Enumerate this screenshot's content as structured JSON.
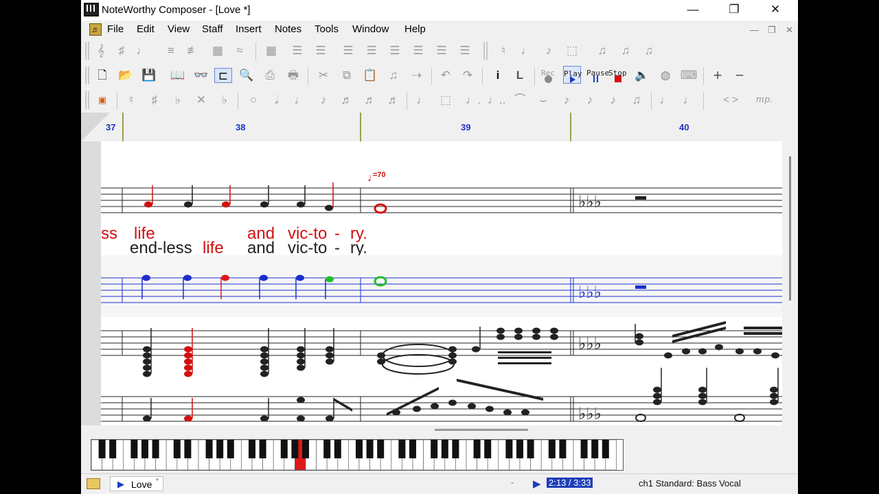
{
  "window": {
    "title": "NoteWorthy Composer - [Love *]"
  },
  "menu": [
    "File",
    "Edit",
    "View",
    "Staff",
    "Insert",
    "Notes",
    "Tools",
    "Window",
    "Help"
  ],
  "toolbar": {
    "rec_label": "Rec",
    "play_label": "Play",
    "pause_label": "Pause",
    "stop_label": "Stop",
    "zoom_in": "+",
    "zoom_out": "−",
    "hairpins": "< >",
    "dynamic": "mp."
  },
  "ruler": {
    "measures": [
      "37",
      "38",
      "39",
      "40"
    ]
  },
  "score": {
    "tempo": "=70",
    "lyrics_line1": [
      {
        "text": "ss",
        "color": "#d21010"
      },
      {
        "text": "life",
        "color": "#d21010"
      },
      {
        "text": "and",
        "color": "#d21010"
      },
      {
        "text": "vic-to",
        "color": "#d21010"
      },
      {
        "text": "-",
        "color": "#d21010"
      },
      {
        "text": "ry.",
        "color": "#d21010"
      }
    ],
    "lyrics_line2": [
      {
        "text": "end-less",
        "color": "#222222"
      },
      {
        "text": "life",
        "color": "#d21010"
      },
      {
        "text": "and",
        "color": "#222222"
      },
      {
        "text": "vic-to",
        "color": "#222222"
      },
      {
        "text": "-",
        "color": "#222222"
      },
      {
        "text": "ry.",
        "color": "#222222"
      }
    ],
    "colors": {
      "active_staff": "#1b2fd0",
      "highlight": "#e01818",
      "played_green": "#1fbf2a",
      "measure_line": "#9aa04a"
    }
  },
  "statusbar": {
    "tab_label": "Love",
    "tab_modified": "*",
    "indicator": "-",
    "time": "2:13 / 3:33",
    "status": "ch1 Standard: Bass Vocal"
  },
  "icons": {
    "titlebar": [
      "app-icon",
      "minimize-icon",
      "restore-icon",
      "close-icon"
    ],
    "files": [
      "new-file-icon",
      "open-folder-icon",
      "save-icon"
    ]
  }
}
